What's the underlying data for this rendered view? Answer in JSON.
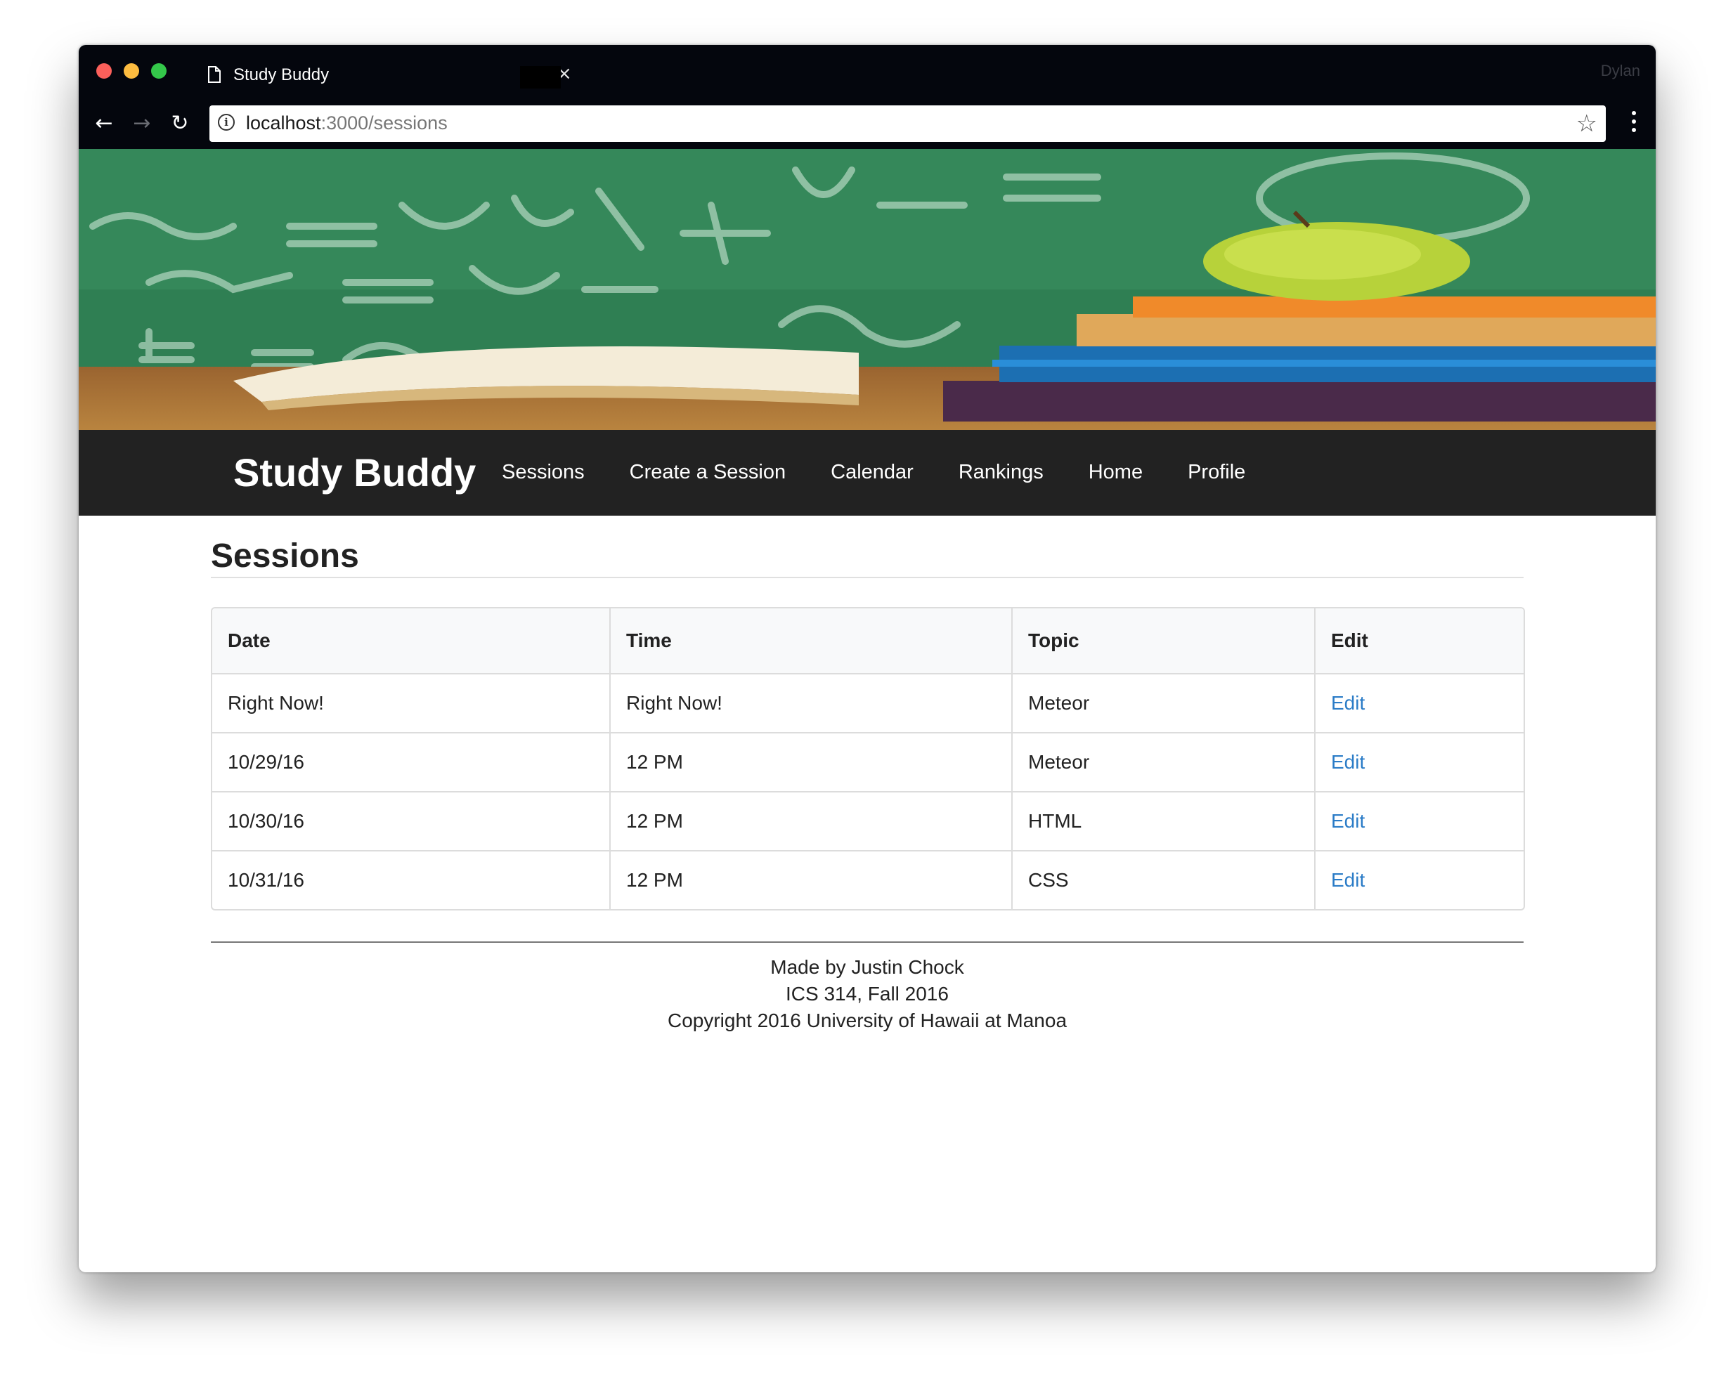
{
  "browser": {
    "tab_title": "Study Buddy",
    "tab_close": "×",
    "profile_name": "Dylan",
    "url_host": "localhost",
    "url_path": ":3000/sessions",
    "back_icon": "←",
    "forward_icon": "→",
    "reload_icon": "↻",
    "info_icon": "i",
    "star_icon": "☆"
  },
  "navbar": {
    "brand": "Study Buddy",
    "links": [
      "Sessions",
      "Create a Session",
      "Calendar",
      "Rankings",
      "Home",
      "Profile"
    ]
  },
  "page": {
    "title": "Sessions"
  },
  "table": {
    "headers": [
      "Date",
      "Time",
      "Topic",
      "Edit"
    ],
    "rows": [
      {
        "date": "Right Now!",
        "time": "Right Now!",
        "topic": "Meteor",
        "edit": "Edit"
      },
      {
        "date": "10/29/16",
        "time": "12 PM",
        "topic": "Meteor",
        "edit": "Edit"
      },
      {
        "date": "10/30/16",
        "time": "12 PM",
        "topic": "HTML",
        "edit": "Edit"
      },
      {
        "date": "10/31/16",
        "time": "12 PM",
        "topic": "CSS",
        "edit": "Edit"
      }
    ]
  },
  "footer": {
    "line1": "Made by Justin Chock",
    "line2": "ICS 314, Fall 2016",
    "line3": "Copyright 2016 University of Hawaii at Manoa"
  },
  "colors": {
    "navbar_bg": "#222222",
    "link": "#2b7cc7",
    "chrome_bg": "#04060d"
  }
}
